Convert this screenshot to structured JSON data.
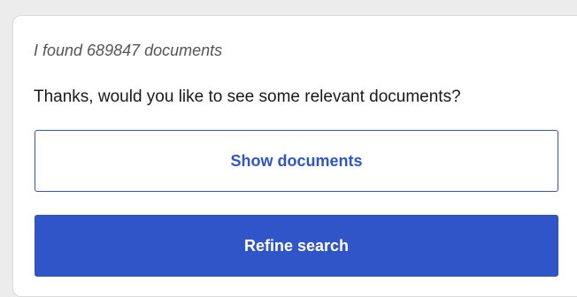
{
  "message": {
    "found_text": "I found 689847 documents",
    "question": "Thanks, would you like to see some relevant documents?"
  },
  "actions": {
    "show_documents_label": "Show documents",
    "refine_search_label": "Refine search"
  },
  "colors": {
    "accent": "#2f55c8",
    "background": "#ececec",
    "card": "#ffffff"
  }
}
